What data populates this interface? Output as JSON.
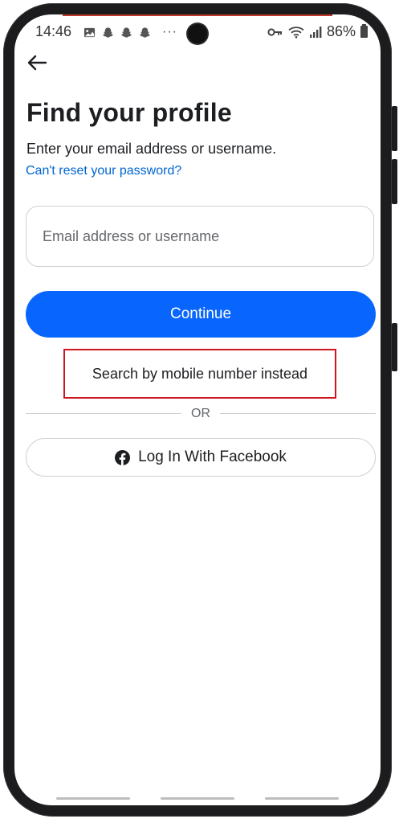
{
  "statusbar": {
    "time": "14:46",
    "battery_text": "86%",
    "overflow": "···",
    "icons_left": [
      "gallery-icon",
      "snapchat-icon",
      "snapchat-icon",
      "snapchat-icon"
    ],
    "icons_right": [
      "key-icon",
      "wifi-icon",
      "signal-icon",
      "battery-icon"
    ]
  },
  "header": {
    "back_icon": "arrow-left-icon"
  },
  "page": {
    "title": "Find your profile",
    "subtitle": "Enter your email address or username.",
    "help_link": "Can't reset your password?"
  },
  "form": {
    "email_value": "",
    "email_placeholder": "Email address or username",
    "continue_label": "Continue",
    "alt_search_label": "Search by mobile number instead",
    "or_label": "OR",
    "facebook_label": "Log In With Facebook",
    "facebook_icon": "facebook-icon"
  },
  "colors": {
    "primary": "#0866ff",
    "link": "#0064d1",
    "highlight_border": "#d0141f",
    "text": "#1c1e21",
    "muted": "#65676b"
  }
}
